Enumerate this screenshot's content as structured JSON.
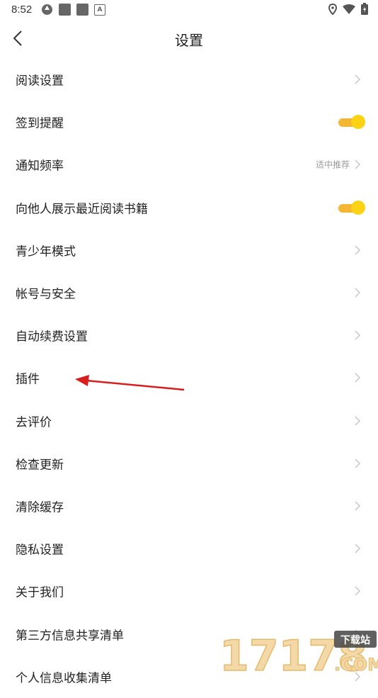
{
  "status_bar": {
    "time": "8:52"
  },
  "header": {
    "title": "设置"
  },
  "items": [
    {
      "label": "阅读设置",
      "control": "chevron"
    },
    {
      "label": "签到提醒",
      "control": "toggle",
      "on": true
    },
    {
      "label": "通知频率",
      "control": "chevron",
      "value": "适中推荐"
    },
    {
      "label": "向他人展示最近阅读书籍",
      "control": "toggle",
      "on": true
    },
    {
      "label": "青少年模式",
      "control": "chevron"
    },
    {
      "label": "帐号与安全",
      "control": "chevron"
    },
    {
      "label": "自动续费设置",
      "control": "chevron"
    },
    {
      "label": "插件",
      "control": "chevron"
    },
    {
      "label": "去评价",
      "control": "chevron"
    },
    {
      "label": "检查更新",
      "control": "chevron"
    },
    {
      "label": "清除缓存",
      "control": "chevron"
    },
    {
      "label": "隐私设置",
      "control": "chevron"
    },
    {
      "label": "关于我们",
      "control": "chevron"
    },
    {
      "label": "第三方信息共享清单",
      "control": "chevron"
    },
    {
      "label": "个人信息收集清单",
      "control": "chevron"
    }
  ],
  "watermark": {
    "number": "17178",
    "tag": "下载站",
    "domain": ".COM"
  },
  "colors": {
    "toggle_track": "#f5b632",
    "toggle_knob": "#fbd314",
    "annotation_arrow": "#d81e1e"
  }
}
